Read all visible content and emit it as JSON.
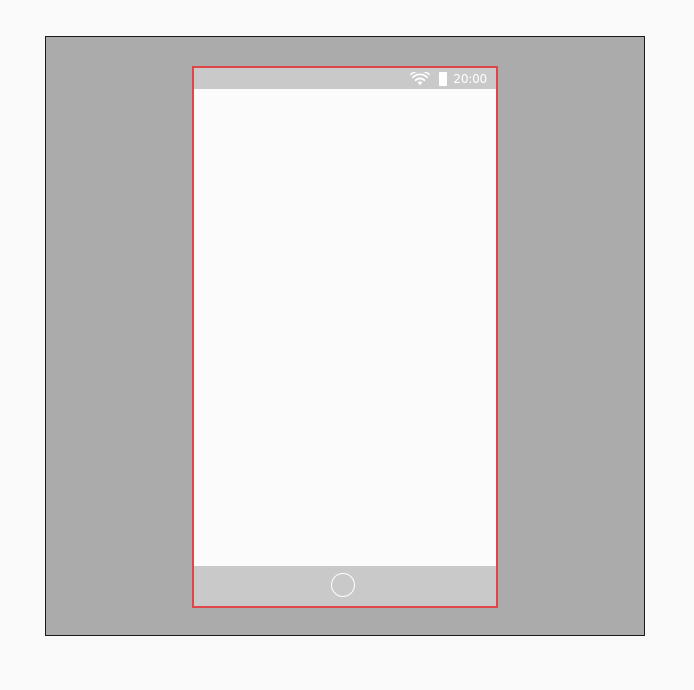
{
  "status_bar": {
    "time": "20:00",
    "icons": [
      "wifi-icon",
      "battery-icon"
    ]
  },
  "nav_bar": {
    "icons": [
      "home-circle-icon"
    ]
  },
  "colors": {
    "backdrop": "#ababab",
    "frame_border": "#e0454a",
    "bars": "#c9c9c9",
    "screen": "#fbfbfb"
  }
}
